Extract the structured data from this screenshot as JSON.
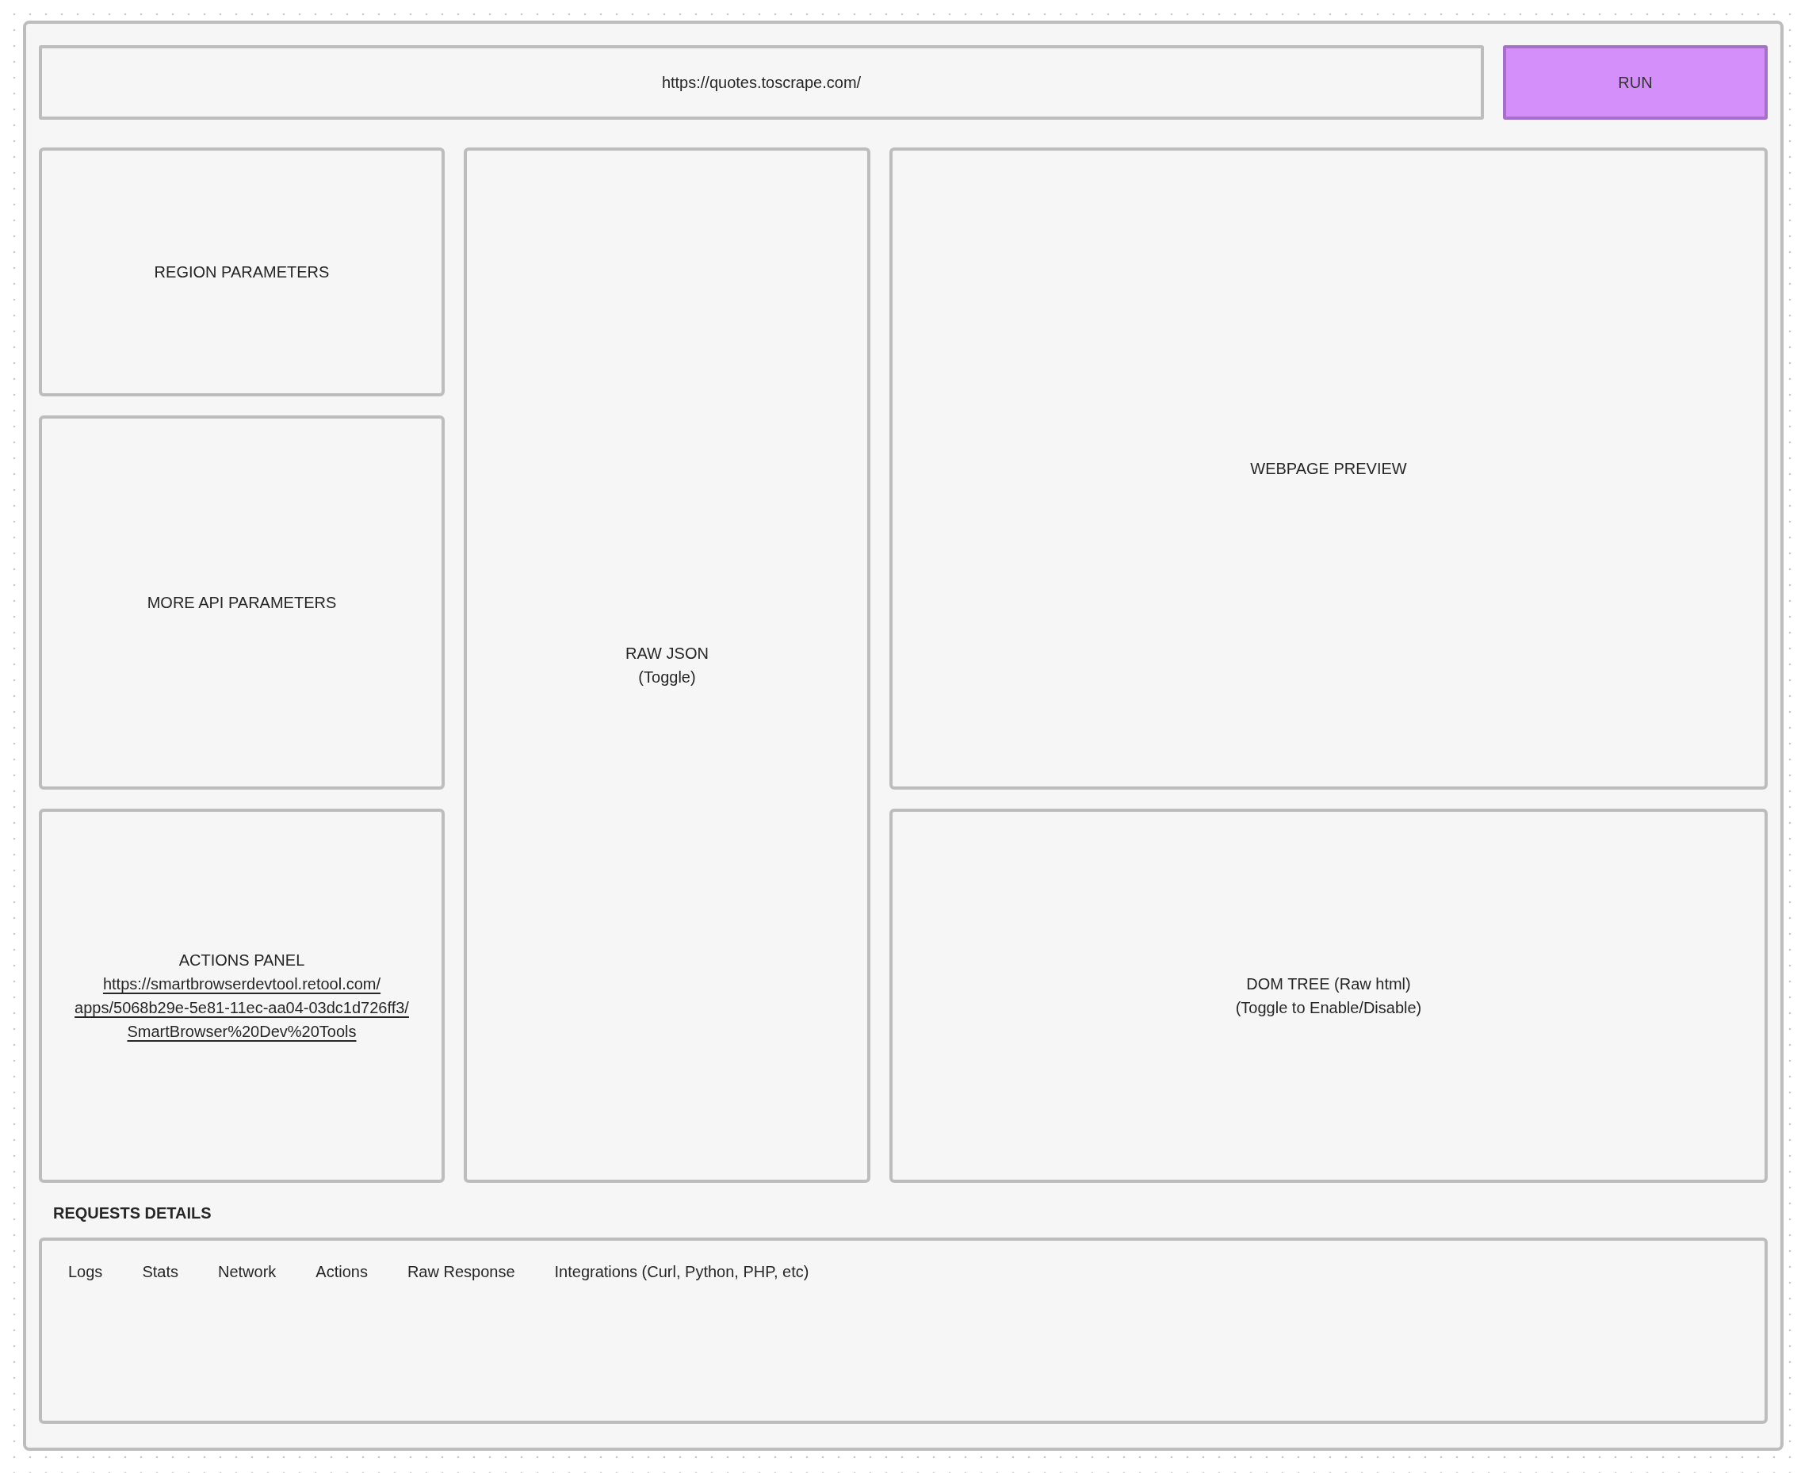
{
  "url_bar": {
    "value": "https://quotes.toscrape.com/"
  },
  "run_button": {
    "label": "RUN"
  },
  "left_panels": [
    {
      "lines": [
        "REGION PARAMETERS"
      ]
    },
    {
      "lines": [
        "MORE API PARAMETERS"
      ]
    },
    {
      "lines": [
        "ACTIONS PANEL"
      ],
      "link_lines": [
        "https://smartbrowserdevtool.retool.com/",
        "apps/5068b29e-5e81-11ec-aa04-03dc1d726ff3/",
        "SmartBrowser%20Dev%20Tools"
      ]
    }
  ],
  "center_panel": {
    "lines": [
      "RAW JSON",
      "(Toggle)"
    ]
  },
  "right_panels": [
    {
      "lines": [
        "WEBPAGE PREVIEW"
      ]
    },
    {
      "lines": [
        "DOM TREE (Raw html)",
        "(Toggle to Enable/Disable)"
      ]
    }
  ],
  "requests_details": {
    "title": "REQUESTS DETAILS",
    "tabs": [
      "Logs",
      "Stats",
      "Network",
      "Actions",
      "Raw Response",
      "Integrations (Curl, Python, PHP, etc)"
    ]
  }
}
